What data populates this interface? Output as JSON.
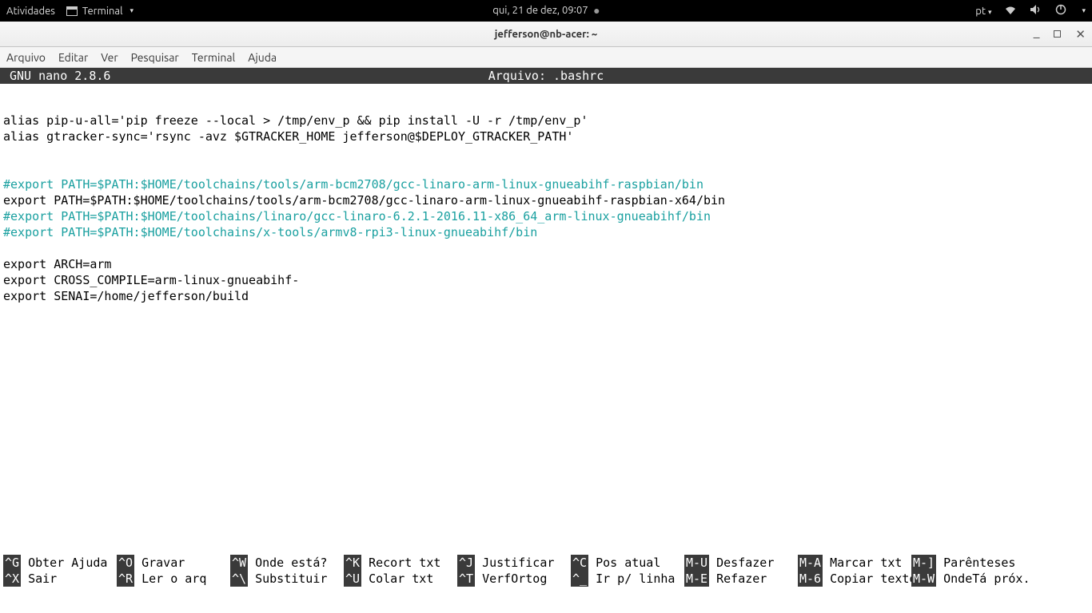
{
  "gnome": {
    "activities": "Atividades",
    "app_name": "Terminal",
    "clock": "qui, 21 de dez, 09∶07",
    "lang": "pt"
  },
  "window": {
    "title": "jefferson@nb-acer: ~"
  },
  "menus": {
    "arquivo": "Arquivo",
    "editar": "Editar",
    "ver": "Ver",
    "pesquisar": "Pesquisar",
    "terminal": "Terminal",
    "ajuda": "Ajuda"
  },
  "nano": {
    "version": "GNU nano 2.8.6",
    "file_label": "Arquivo: .bashrc"
  },
  "content": {
    "l1": "alias pip-u-all='pip freeze --local > /tmp/env_p && pip install -U -r /tmp/env_p'",
    "l2": "alias gtracker-sync='rsync -avz $GTRACKER_HOME jefferson@$DEPLOY_GTRACKER_PATH'",
    "l3": "",
    "l4": "",
    "l5": "#export PATH=$PATH:$HOME/toolchains/tools/arm-bcm2708/gcc-linaro-arm-linux-gnueabihf-raspbian/bin",
    "l6": "export PATH=$PATH:$HOME/toolchains/tools/arm-bcm2708/gcc-linaro-arm-linux-gnueabihf-raspbian-x64/bin",
    "l7": "#export PATH=$PATH:$HOME/toolchains/linaro/gcc-linaro-6.2.1-2016.11-x86_64_arm-linux-gnueabihf/bin",
    "l8": "#export PATH=$PATH:$HOME/toolchains/x-tools/armv8-rpi3-linux-gnueabihf/bin",
    "l9": "",
    "l10": "export ARCH=arm",
    "l11": "export CROSS_COMPILE=arm-linux-gnueabihf-",
    "l12": "export SENAI=/home/jefferson/build"
  },
  "shortcuts": {
    "r1c0k": "^G",
    "r1c0l": " Obter Ajuda",
    "r1c1k": "^O",
    "r1c1l": " Gravar",
    "r1c2k": "^W",
    "r1c2l": " Onde está?",
    "r1c3k": "^K",
    "r1c3l": " Recort txt",
    "r1c4k": "^J",
    "r1c4l": " Justificar",
    "r1c5k": "^C",
    "r1c5l": " Pos atual",
    "r1c6k": "M-U",
    "r1c6l": " Desfazer",
    "r1c7k": "M-A",
    "r1c7l": " Marcar txt",
    "r1c8k": "M-]",
    "r1c8l": " Parênteses",
    "r2c0k": "^X",
    "r2c0l": " Sair",
    "r2c1k": "^R",
    "r2c1l": " Ler o arq",
    "r2c2k": "^\\",
    "r2c2l": " Substituir",
    "r2c3k": "^U",
    "r2c3l": " Colar txt",
    "r2c4k": "^T",
    "r2c4l": " VerfOrtog",
    "r2c5k": "^_",
    "r2c5l": " Ir p/ linha",
    "r2c6k": "M-E",
    "r2c6l": " Refazer",
    "r2c7k": "M-6",
    "r2c7l": " Copiar texto",
    "r2c8k": "M-W",
    "r2c8l": " OndeTá próx."
  }
}
